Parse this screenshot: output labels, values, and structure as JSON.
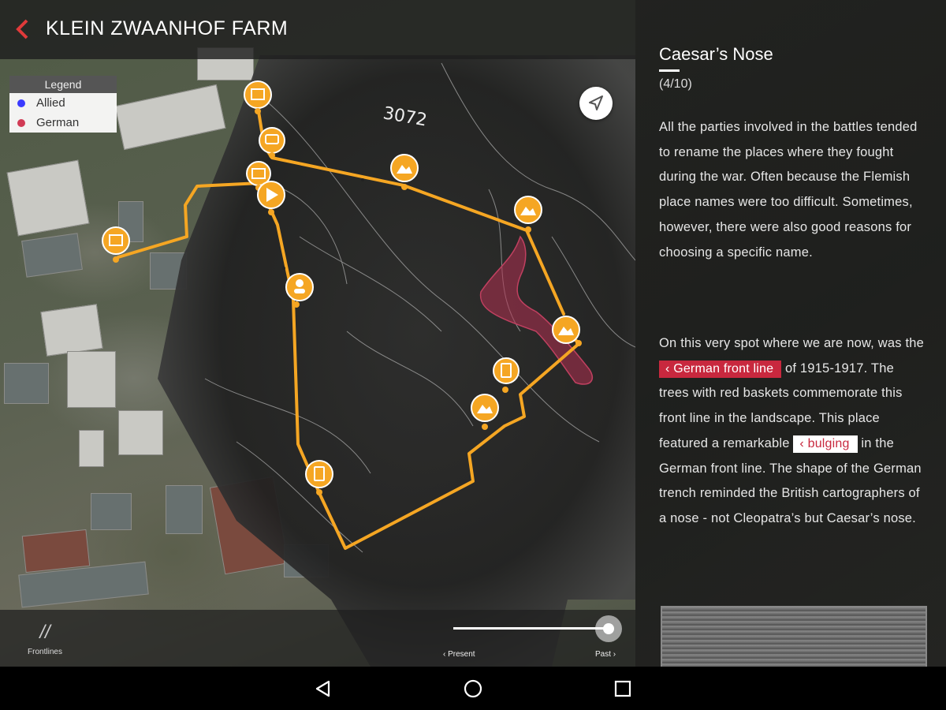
{
  "header": {
    "back_icon": "chevron-left-icon",
    "title": "KLEIN ZWAANHOF FARM"
  },
  "legend": {
    "title": "Legend",
    "items": [
      {
        "label": "Allied",
        "color": "#3b3bff"
      },
      {
        "label": "German",
        "color": "#d13b55"
      }
    ]
  },
  "map": {
    "photo_label": "3072",
    "route_color": "#f5a623",
    "german_zone_color": "#b03050",
    "locate_icon": "navigation-arrow-icon",
    "markers": [
      {
        "icon": "building-icon"
      },
      {
        "icon": "chat-icon"
      },
      {
        "icon": "photos-icon"
      },
      {
        "icon": "play-icon"
      },
      {
        "icon": "building-icon"
      },
      {
        "icon": "person-icon"
      },
      {
        "icon": "image-icon"
      },
      {
        "icon": "image-icon"
      },
      {
        "icon": "image-icon"
      },
      {
        "icon": "document-icon"
      },
      {
        "icon": "image-icon"
      },
      {
        "icon": "document-icon"
      }
    ]
  },
  "bottom_bar": {
    "frontlines_label": "Frontlines",
    "present_label": "‹ Present",
    "past_label": "Past ›",
    "slider_position": 1.0
  },
  "info": {
    "title": "Caesar’s Nose",
    "counter": "(4/10)",
    "paragraph1": "All the parties involved in the battles tended to rename the places where they fought during the war. Often because the Flemish place names were too difficult. Sometimes, however, there were also good reasons for choosing a specific name.",
    "p2_before_link1": "On this very spot where we are now, was the ",
    "link1": "German front line",
    "p2_between_links": " of 1915-1917. The trees with red baskets commemorate this front line in the landscape. This place featured a remarkable ",
    "link2": "bulging",
    "p2_after_link2": " in the German front line. The shape of the German trench reminded the British cartographers of a nose - not Cleopatra’s but Caesar’s nose.",
    "link_icon": "chevron-left-icon"
  },
  "navbar": {
    "back_icon": "triangle-back-icon",
    "home_icon": "circle-home-icon",
    "recents_icon": "square-recents-icon"
  }
}
